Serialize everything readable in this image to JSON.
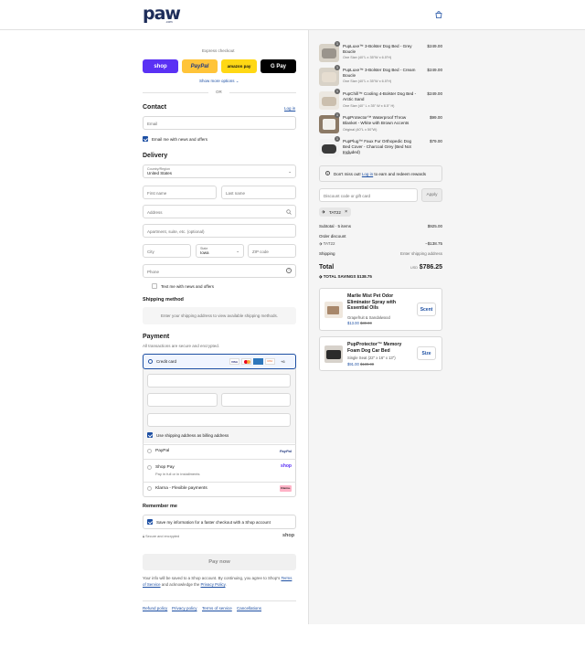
{
  "header": {
    "logo_text": "paw",
    "logo_sub": ".com"
  },
  "express": {
    "label": "Express checkout",
    "shop": "shop",
    "paypal": "PayPal",
    "amazon": "amazon pay",
    "gpay": "G Pay",
    "more": "Show more options",
    "or": "OR"
  },
  "contact": {
    "title": "Contact",
    "login": "Log in",
    "email_placeholder": "Email",
    "news": "Email me with news and offers"
  },
  "delivery": {
    "title": "Delivery",
    "country_label": "Country/Region",
    "country": "United States",
    "first": "First name",
    "last": "Last name",
    "address": "Address",
    "apt": "Apartment, suite, etc. (optional)",
    "city": "City",
    "state_label": "State",
    "state": "Iowa",
    "zip": "ZIP code",
    "phone": "Phone",
    "text_me": "Text me with news and offers"
  },
  "shipping": {
    "title": "Shipping method",
    "note": "Enter your shipping address to view available shipping methods."
  },
  "payment": {
    "title": "Payment",
    "subtitle": "All transactions are secure and encrypted.",
    "credit": "Credit card",
    "card_more": "+6",
    "billing": "Use shipping address as billing address",
    "paypal": "PayPal",
    "shoppay": "Shop Pay",
    "shoppay_sub": "Pay in full or in installments",
    "klarna": "Klarna - Flexible payments",
    "klarna_badge": "Klarna."
  },
  "remember": {
    "title": "Remember me",
    "save": "Save my information for a faster checkout with a Shop account",
    "secure": "Secure and encrypted",
    "shop": "shop"
  },
  "pay_now": "Pay now",
  "legal": {
    "line1": "Your info will be saved to a Shop account. By continuing, you agree to Shop's",
    "tos": "Terms of Service",
    "and": "and acknowledge the",
    "privacy": "Privacy Policy",
    "end": "."
  },
  "footer": [
    "Refund policy",
    "Privacy policy",
    "Terms of service",
    "Cancellations"
  ],
  "cart": {
    "items": [
      {
        "qty": "1",
        "name": "PupLuxe™ 3-Bolster Dog Bed - Grey Boucle",
        "variant": "One Size (40\"L x 35\"W x 6.5\"H)",
        "price": "$249.00"
      },
      {
        "qty": "1",
        "name": "PupLuxe™ 3-Bolster Dog Bed - Cream Boucle",
        "variant": "One Size (40\"L x 35\"W x 6.5\"H)",
        "price": "$249.00"
      },
      {
        "qty": "1",
        "name": "PupChill™ Cooling 4-Bolster Dog Bed - Arctic Sand",
        "variant": "One Size (40\" L x 35\" W x 6.5\" H)",
        "price": "$249.00"
      },
      {
        "qty": "1",
        "name": "PupProtector™ Waterproof Throw Blanket - White with Brown Accents",
        "variant": "Original (40\"L x 50\"W)",
        "price": "$99.00"
      },
      {
        "qty": "1",
        "name": "PupPlug™ Faux Fur Orthopedic Dog Bed Cover - Charcoal Grey (Bed Not Included)",
        "variant": "Giant",
        "price": "$79.00"
      }
    ],
    "rewards": "Don't miss out!",
    "rewards_link": "Log in",
    "rewards_end": "to earn and redeem rewards",
    "discount_placeholder": "Discount code or gift card",
    "apply": "Apply",
    "code": "TAT22",
    "subtotal_label": "Subtotal · 5 items",
    "subtotal": "$925.00",
    "order_discount": "Order discount",
    "code_line": "TAT22",
    "discount_amt": "−$138.75",
    "shipping_label": "Shipping",
    "shipping_val": "Enter shipping address",
    "total_label": "Total",
    "currency": "USD",
    "total": "$786.25",
    "savings_label": "TOTAL SAVINGS",
    "savings": "$138.75"
  },
  "upsells": [
    {
      "name": "Marlie Mist Pet Odor Eliminator Spray with Essential Oils",
      "variant": "Grapefruit & Sandalwood",
      "price": "$13.00",
      "old": "$30.00",
      "button": "Scent"
    },
    {
      "name": "PupProtector™ Memory Foam Dog Car Bed",
      "variant": "Single Seat (22\" x 16\" x 13\")",
      "price": "$91.00",
      "old": "$130.00",
      "button": "Size"
    }
  ]
}
